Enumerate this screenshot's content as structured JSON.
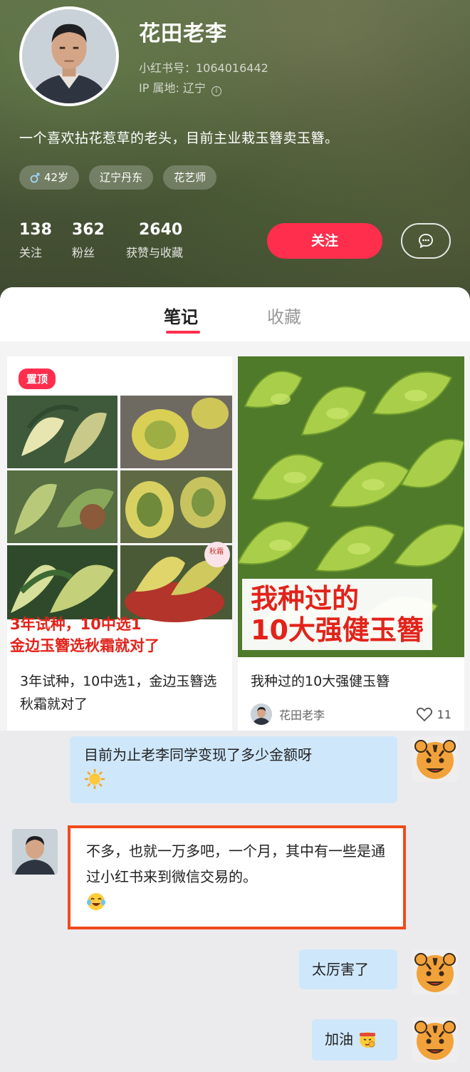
{
  "profile": {
    "name": "花田老李",
    "id_text": "小红书号：1064016442",
    "ip_text": "IP 属地: 辽宁",
    "bio": "一个喜欢拈花惹草的老头，目前主业栽玉簪卖玉簪。",
    "tags": [
      {
        "icon": "gender-male-icon",
        "label": "42岁"
      },
      {
        "icon": "",
        "label": "辽宁丹东"
      },
      {
        "icon": "",
        "label": "花艺师"
      }
    ],
    "stats": [
      {
        "value": "138",
        "label": "关注"
      },
      {
        "value": "362",
        "label": "粉丝"
      },
      {
        "value": "2640",
        "label": "获赞与收藏"
      }
    ],
    "follow_label": "关注"
  },
  "tabs": [
    {
      "label": "笔记",
      "active": true
    },
    {
      "label": "收藏",
      "active": false
    }
  ],
  "notes": [
    {
      "pin_label": "置顶",
      "cover_caption_lines": [
        "3年试种，10中选1",
        "金边玉簪选秋霜就对了"
      ],
      "cover_small_label": "秋霜",
      "title": "3年试种，10中选1，金边玉簪选秋霜就对了"
    },
    {
      "cover_overlay_lines": [
        "我种过的",
        "10大强健玉簪"
      ],
      "title": "我种过的10大强健玉簪",
      "author": "花田老李",
      "likes": "11"
    }
  ],
  "chat": [
    {
      "side": "right",
      "text": "目前为止老李同学变现了多少金额呀",
      "emoji": "sun-emoji"
    },
    {
      "side": "left",
      "text": "不多，也就一万多吧，一个月，其中有一些是通过小红书来到微信交易的。",
      "emoji": "laugh-cry-emoji"
    },
    {
      "side": "right",
      "text": "太厉害了",
      "emoji": ""
    },
    {
      "side": "right",
      "text": "加油",
      "emoji": "fighting-emoji"
    }
  ],
  "colors": {
    "accent": "#ff2e4d",
    "caption_red": "#e2231a",
    "highlight_border": "#f04a1b",
    "bubble_right": "#cfe7fb"
  }
}
